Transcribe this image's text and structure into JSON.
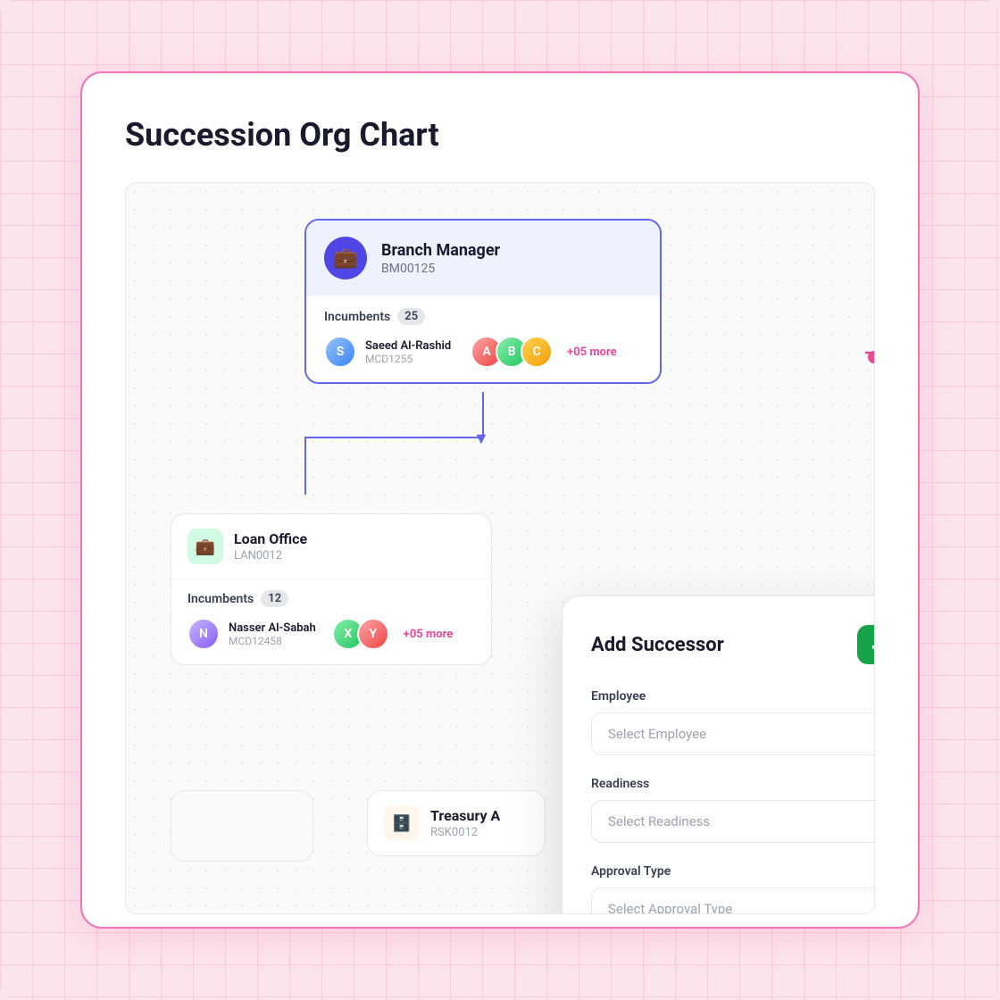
{
  "page": {
    "title": "Succession Org Chart"
  },
  "branch_manager": {
    "title": "Branch Manager",
    "code": "BM00125",
    "incumbents_label": "Incumbents",
    "incumbents_count": "25",
    "person_name": "Saeed Al-Rashid",
    "person_code": "MCD1255",
    "more_label": "+05 more"
  },
  "loan_office": {
    "title": "Loan Office",
    "code": "LAN0012",
    "incumbents_label": "Incumbents",
    "incumbents_count": "12",
    "person_name": "Nasser Al-Sabah",
    "person_code": "MCD12458",
    "more_label": "+05 more"
  },
  "treasury": {
    "title": "Treasury A",
    "code": "RSK0012"
  },
  "add_successor": {
    "title": "Add Successor",
    "confirm_icon": "✓",
    "cancel_icon": "✕",
    "employee_label": "Employee",
    "employee_placeholder": "Select Employee",
    "readiness_label": "Readiness",
    "readiness_placeholder": "Select Readiness",
    "approval_label": "Approval Type",
    "approval_placeholder": "Select Approval Type"
  }
}
